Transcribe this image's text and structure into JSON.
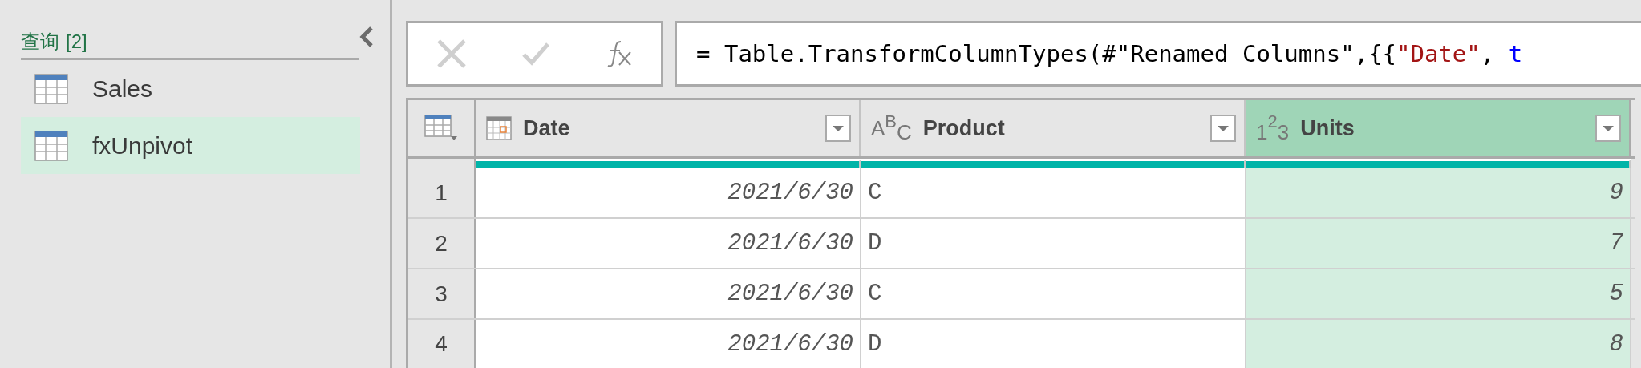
{
  "sidebar": {
    "title": "查询",
    "count": "[2]",
    "items": [
      {
        "label": "Sales",
        "selected": false
      },
      {
        "label": "fxUnpivot",
        "selected": true
      }
    ]
  },
  "formula_bar": {
    "tokens": [
      {
        "text": "= Table.TransformColumnTypes(#\"Renamed Columns\",{{",
        "kind": "plain"
      },
      {
        "text": "\"Date\"",
        "kind": "string"
      },
      {
        "text": ", ",
        "kind": "plain"
      },
      {
        "text": "t",
        "kind": "keyword"
      }
    ]
  },
  "table": {
    "columns": [
      {
        "name": "Date",
        "kind": "date",
        "selected": false
      },
      {
        "name": "Product",
        "kind": "text",
        "selected": false,
        "type_glyphs": [
          "A",
          "B",
          "C"
        ]
      },
      {
        "name": "Units",
        "kind": "number",
        "selected": true,
        "type_glyphs": [
          "1",
          "2",
          "3"
        ]
      }
    ],
    "rows": [
      {
        "number": "1",
        "cells": [
          "2021/6/30",
          "C",
          "9"
        ]
      },
      {
        "number": "2",
        "cells": [
          "2021/6/30",
          "D",
          "7"
        ]
      },
      {
        "number": "3",
        "cells": [
          "2021/6/30",
          "C",
          "5"
        ]
      },
      {
        "number": "4",
        "cells": [
          "2021/6/30",
          "D",
          "8"
        ]
      }
    ]
  }
}
